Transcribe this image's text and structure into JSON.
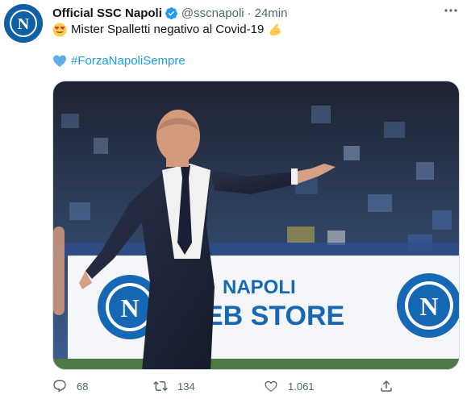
{
  "author": {
    "name": "Official SSC Napoli",
    "handle": "@sscnapoli",
    "separator": "·",
    "time": "24min",
    "avatar_letter": "N"
  },
  "tweet": {
    "line1_emoji": "heart-eyes-emoji",
    "line1_text": "Mister Spalletti negativo al Covid-19",
    "line1_emoji_after": "flexed-biceps-emoji",
    "line2_emoji": "blue-heart-emoji",
    "hashtag": "#ForzaNapoliSempre"
  },
  "media": {
    "sign_letter": "N",
    "sign_text_top": "NAPOLI",
    "sign_text_bottom": "EB STORE"
  },
  "actions": {
    "reply_count": "68",
    "retweet_count": "134",
    "like_count": "1.061"
  },
  "colors": {
    "link": "#1d9bf0",
    "secondary_text": "#536471",
    "napoli_blue": "#0f5fa6"
  }
}
